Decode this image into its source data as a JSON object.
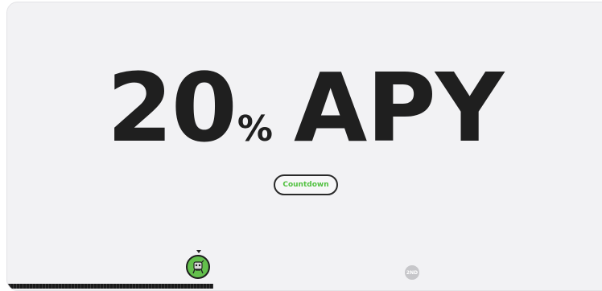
{
  "headline": {
    "number": "20",
    "percent": "%",
    "label": "APY"
  },
  "countdown_button": {
    "label": "Countdown"
  },
  "timeline": {
    "progress": 0.34,
    "current_avatar_icon": "mascot-avatar-icon",
    "next_marker_label": "2ND"
  },
  "colors": {
    "card_background": "#f2f2f4",
    "headline_text": "#1f1f1f",
    "accent_green": "#52c141",
    "avatar_green": "#63c04c",
    "next_marker": "#c7c7ca"
  }
}
